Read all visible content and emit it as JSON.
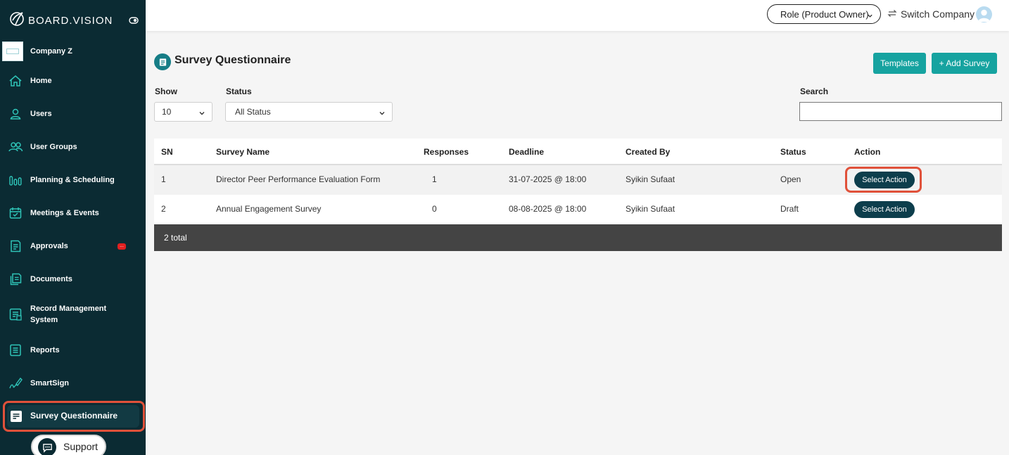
{
  "brand": {
    "name": "BOARD.VISION"
  },
  "company": {
    "name": "Company Z"
  },
  "sidebar": {
    "items": [
      {
        "label": "Home",
        "icon": "home-icon"
      },
      {
        "label": "Users",
        "icon": "user-icon"
      },
      {
        "label": "User Groups",
        "icon": "user-group-icon"
      },
      {
        "label": "Planning & Scheduling",
        "icon": "planning-icon"
      },
      {
        "label": "Meetings & Events",
        "icon": "calendar-icon"
      },
      {
        "label": "Approvals",
        "icon": "approval-icon",
        "badge": "..."
      },
      {
        "label": "Documents",
        "icon": "documents-icon"
      },
      {
        "label": "Record Management System",
        "icon": "record-icon"
      },
      {
        "label": "Reports",
        "icon": "reports-icon"
      },
      {
        "label": "SmartSign",
        "icon": "signature-icon"
      },
      {
        "label": "Survey Questionnaire",
        "icon": "survey-icon",
        "active": true
      }
    ],
    "support_label": "Support"
  },
  "topbar": {
    "role_label": "Role (Product Owner)",
    "switch_label": "Switch Company"
  },
  "page": {
    "title": "Survey Questionnaire",
    "templates_label": "Templates",
    "add_label": "+ Add Survey"
  },
  "filters": {
    "show_label": "Show",
    "show_value": "10",
    "status_label": "Status",
    "status_value": "All Status",
    "search_label": "Search",
    "search_value": ""
  },
  "table": {
    "columns": [
      "SN",
      "Survey Name",
      "Responses",
      "Deadline",
      "Created By",
      "Status",
      "Action"
    ],
    "rows": [
      {
        "sn": "1",
        "name": "Director Peer Performance Evaluation Form",
        "responses": "1",
        "deadline": "31-07-2025 @ 18:00",
        "created_by": "Syikin Sufaat",
        "status": "Open",
        "action": "Select Action"
      },
      {
        "sn": "2",
        "name": "Annual Engagement Survey",
        "responses": "0",
        "deadline": "08-08-2025 @ 18:00",
        "created_by": "Syikin Sufaat",
        "status": "Draft",
        "action": "Select Action"
      }
    ],
    "footer": "2 total"
  },
  "colors": {
    "sidebar_bg": "#0b2b33",
    "accent": "#16a3a0",
    "action_button": "#0d3e4c",
    "highlight": "#e0513a"
  }
}
